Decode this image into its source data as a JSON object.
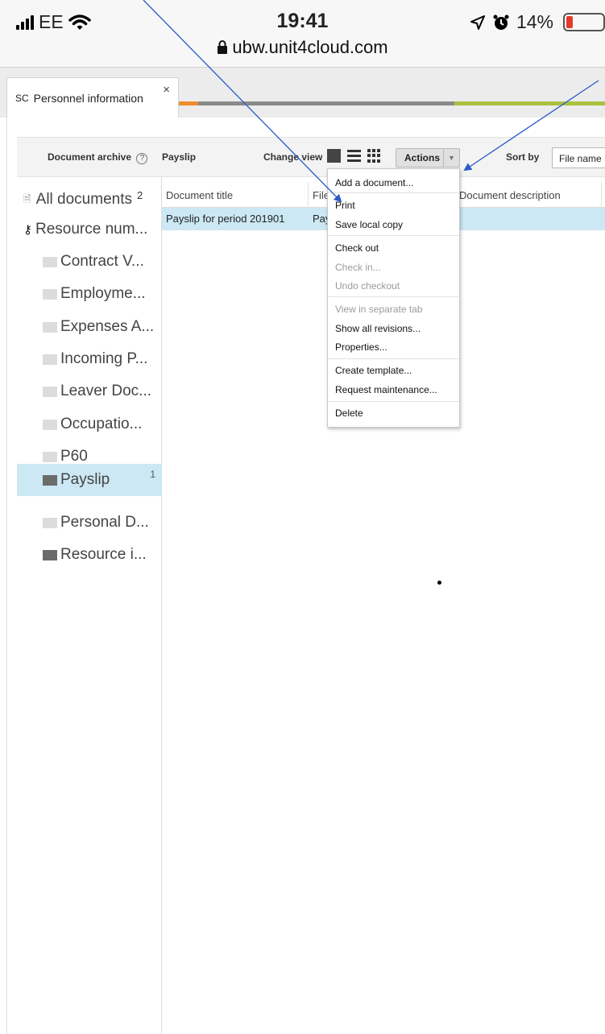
{
  "status_bar": {
    "carrier": "EE",
    "time": "19:41",
    "battery": "14%",
    "battery_level": 0.14,
    "url": "ubw.unit4cloud.com"
  },
  "tab": {
    "code": "SC",
    "title": "Personnel information",
    "close": "×"
  },
  "toolbar": {
    "archive_label": "Document archive",
    "help": "?",
    "breadcrumb": "Payslip",
    "change_view_label": "Change view",
    "actions_label": "Actions",
    "sort_by_label": "Sort by",
    "sort_by_value": "File name"
  },
  "tree": {
    "items": [
      {
        "label": "All documents",
        "count": "2"
      },
      {
        "label": "Resource num..."
      },
      {
        "label": "Contract V..."
      },
      {
        "label": "Employme..."
      },
      {
        "label": "Expenses A..."
      },
      {
        "label": "Incoming P..."
      },
      {
        "label": "Leaver Doc..."
      },
      {
        "label": "Occupatio..."
      },
      {
        "label": "P60"
      },
      {
        "label": "Payslip",
        "count": "1"
      },
      {
        "label": "Personal D..."
      },
      {
        "label": "Resource i..."
      }
    ]
  },
  "list": {
    "columns": [
      "Document title",
      "File",
      "Document description"
    ],
    "rows": [
      {
        "title": "Payslip for period 201901",
        "file": "Pay",
        "description": ""
      }
    ]
  },
  "menu": {
    "items": [
      {
        "label": "Add a document...",
        "enabled": true
      },
      {
        "label": "Print",
        "enabled": true
      },
      {
        "label": "Save local copy",
        "enabled": true
      },
      {
        "label": "Check out",
        "enabled": true
      },
      {
        "label": "Check in...",
        "enabled": false
      },
      {
        "label": "Undo checkout",
        "enabled": false
      },
      {
        "label": "View in separate tab",
        "enabled": false
      },
      {
        "label": "Show all revisions...",
        "enabled": true
      },
      {
        "label": "Properties...",
        "enabled": true
      },
      {
        "label": "Create template...",
        "enabled": true
      },
      {
        "label": "Request maintenance...",
        "enabled": true
      },
      {
        "label": "Delete",
        "enabled": true
      }
    ]
  },
  "colors": {
    "selection": "#cbe8f4",
    "arrow": "#2a5bc7",
    "battery_low": "#e53a2b"
  }
}
